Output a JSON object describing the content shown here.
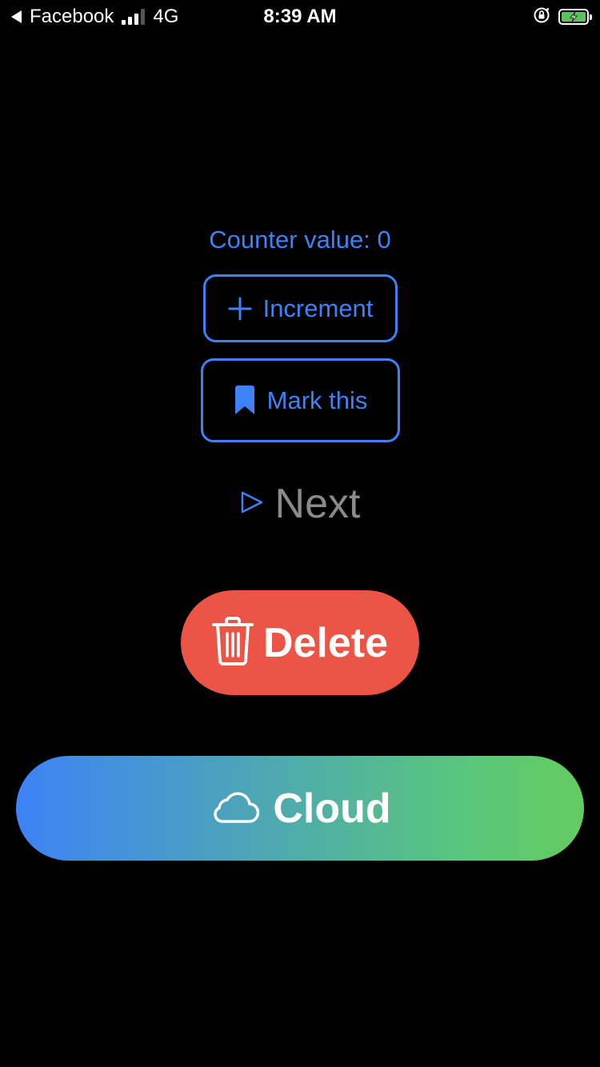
{
  "status_bar": {
    "back_app": "Facebook",
    "network": "4G",
    "time": "8:39 AM",
    "signal_bars_active": 3,
    "battery_color": "#5ac35c"
  },
  "main": {
    "counter_label": "Counter value: 0",
    "increment_label": "Increment",
    "mark_label": "Mark this",
    "next_label": "Next",
    "delete_label": "Delete",
    "cloud_label": "Cloud"
  },
  "colors": {
    "accent": "#3e82f7",
    "delete": "#ec5546",
    "gradient_start": "#3e82f7",
    "gradient_end": "#63cb60",
    "muted_text": "#8a8a8a"
  },
  "icons": {
    "increment": "plus-icon",
    "mark": "bookmark-icon",
    "next": "play-outline-icon",
    "delete": "trash-icon",
    "cloud": "cloud-icon"
  }
}
